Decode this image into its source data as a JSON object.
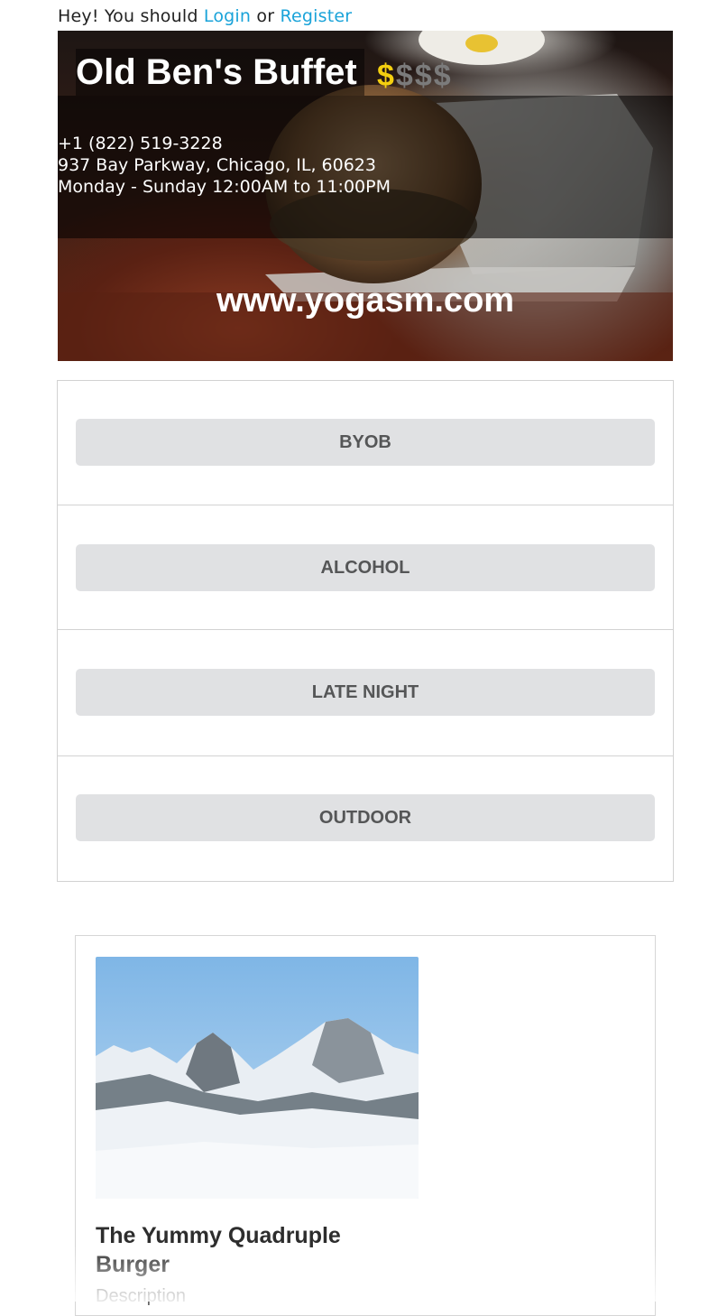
{
  "topbar": {
    "prefix": "Hey! You should",
    "login": "Login",
    "or": "or",
    "register": "Register"
  },
  "restaurant": {
    "name": "Old Ben's Buffet",
    "price_symbol": "$",
    "price_level": 1,
    "price_max": 4,
    "phone": "+1 (822) 519-3228",
    "address": "937 Bay Parkway, Chicago, IL, 60623",
    "hours": "Monday - Sunday 12:00AM to 11:00PM",
    "website": "www.yogasm.com"
  },
  "features": [
    {
      "label": "BYOB"
    },
    {
      "label": "ALCOHOL"
    },
    {
      "label": "LATE NIGHT"
    },
    {
      "label": "OUTDOOR"
    }
  ],
  "menu_item": {
    "title": "The Yummy Quadruple Burger",
    "description_label": "Description"
  },
  "colors": {
    "link": "#1aa3d9",
    "price_active": "#f4cf0f",
    "price_inactive": "#7b7b7b",
    "button_bg": "#e0e1e3"
  }
}
